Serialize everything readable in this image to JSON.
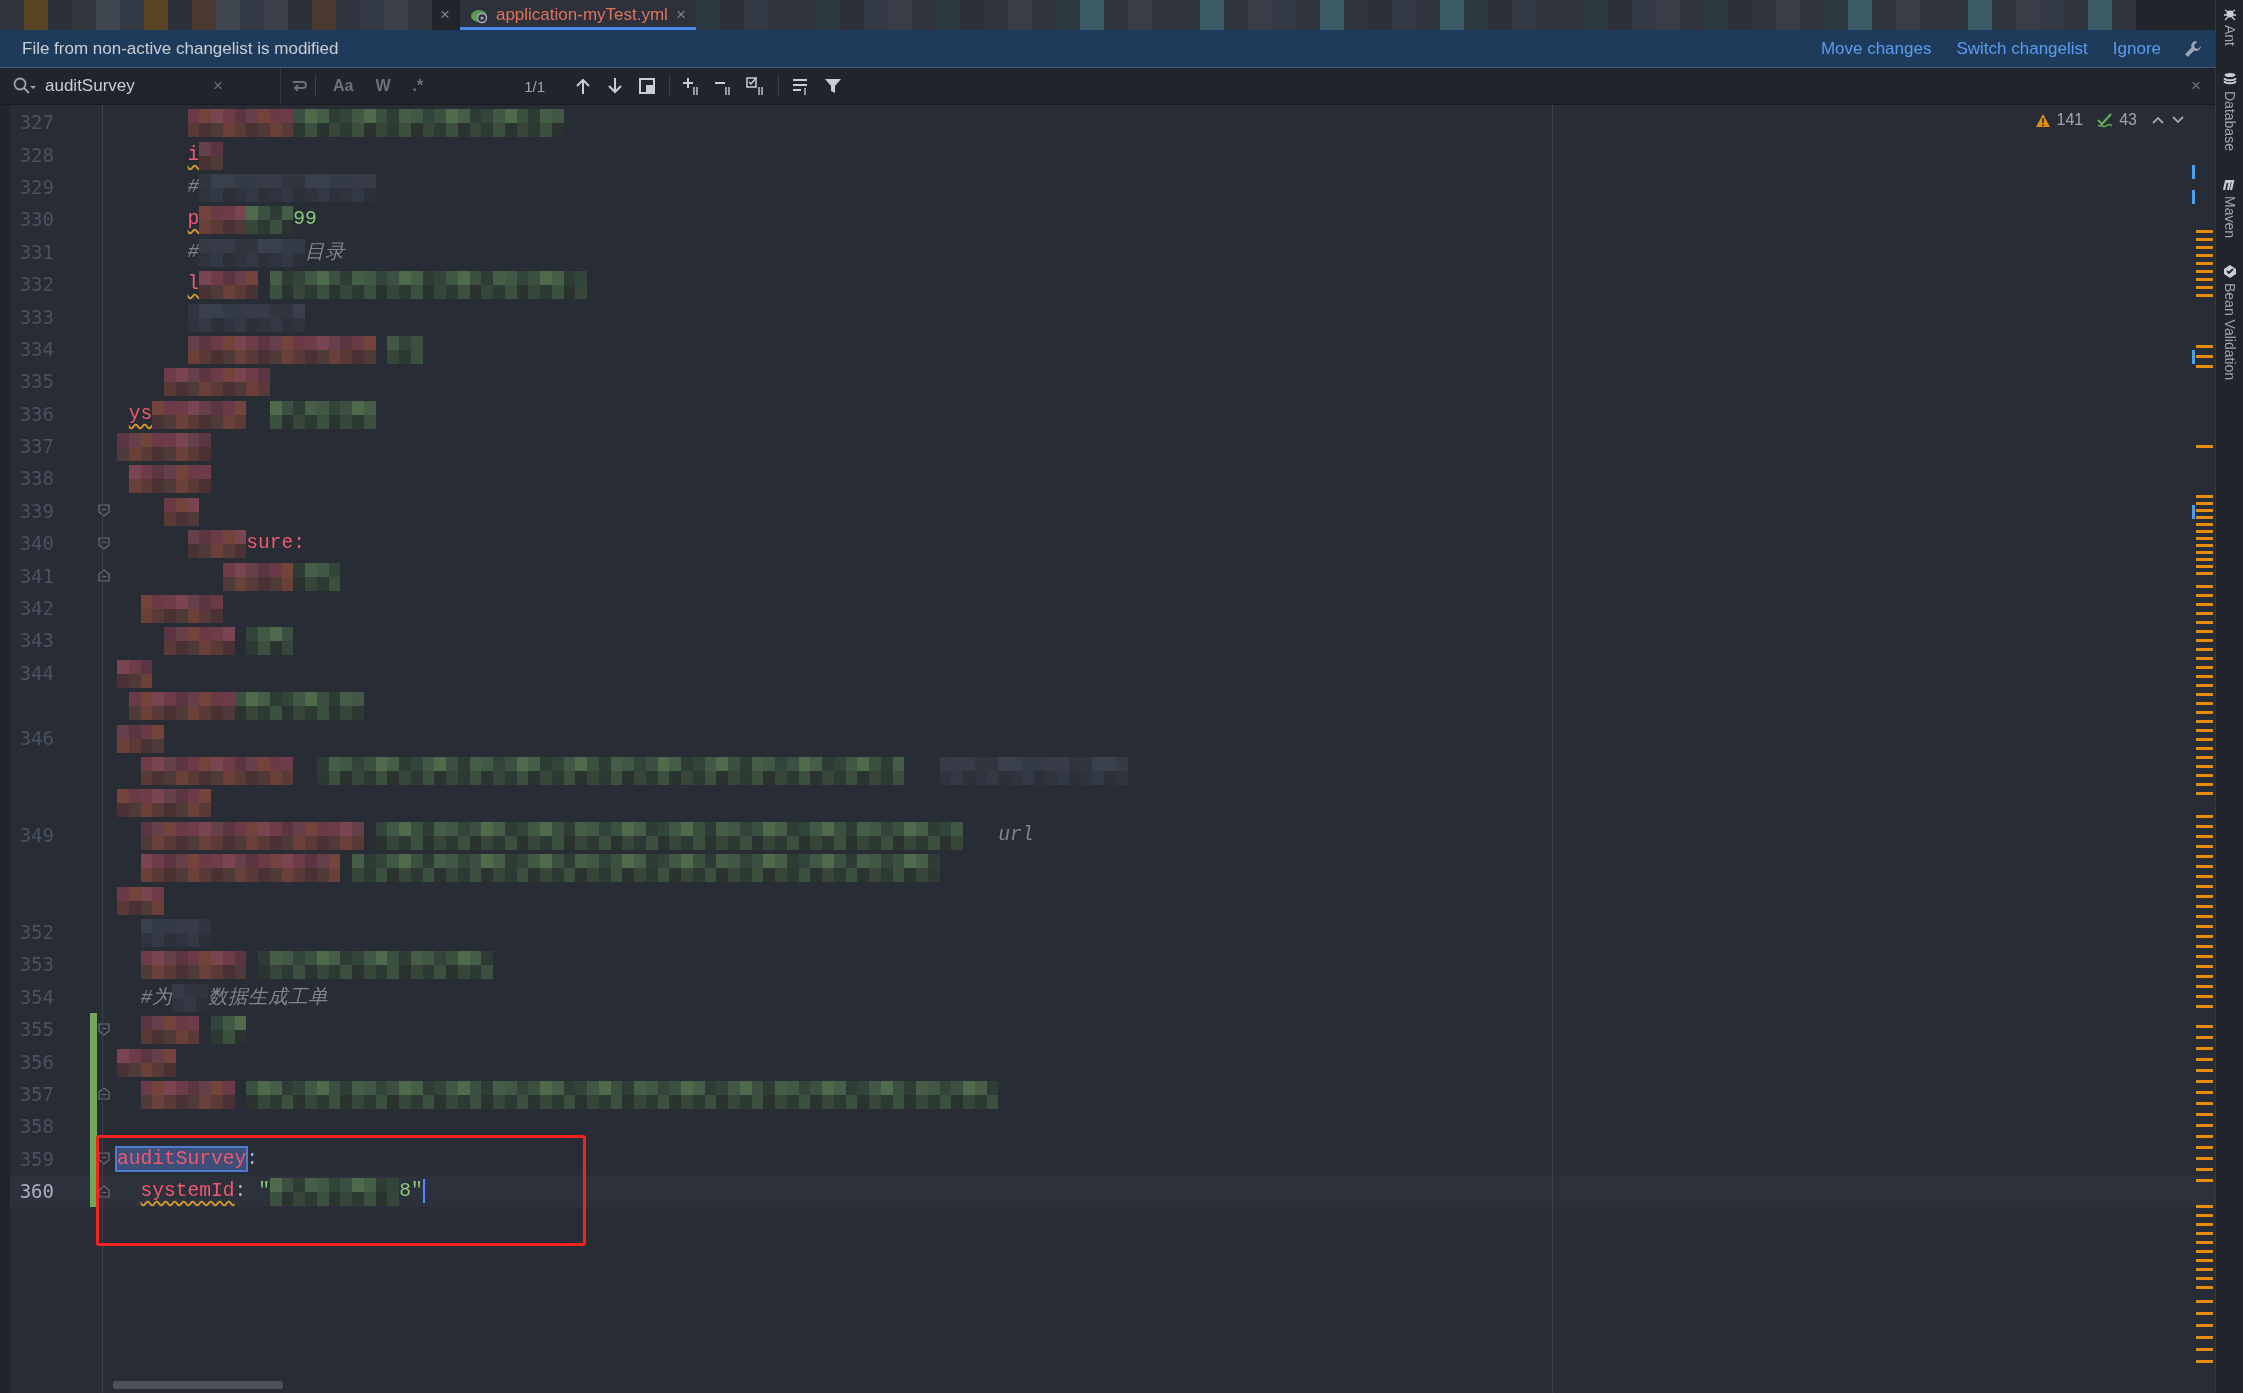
{
  "tabs": [
    {
      "kind": "mosaic",
      "close": "×",
      "selected": false
    },
    {
      "kind": "file",
      "label": "application-myTest.yml",
      "close": "×",
      "selected": true
    }
  ],
  "banner": {
    "message": "File from non-active changelist is modified",
    "actions": [
      "Move changes",
      "Switch changelist",
      "Ignore"
    ]
  },
  "search": {
    "value": "auditSurvey",
    "clear": "×",
    "toggles": [
      {
        "label": "Aa",
        "on": false
      },
      {
        "label": "W",
        "on": false
      },
      {
        "label": ".*",
        "on": false
      }
    ],
    "match_count": "1/1",
    "close": "×"
  },
  "inspections": {
    "warnings": "141",
    "weak_warnings": "43"
  },
  "lines": [
    {
      "number": "327",
      "current": false,
      "changed": false,
      "fold_start": false,
      "fold_end": false
    },
    {
      "number": "328",
      "current": false,
      "changed": false,
      "fold_start": false,
      "fold_end": false,
      "fragments": [
        {
          "kind": "key",
          "text": "i",
          "squiggle": true
        }
      ]
    },
    {
      "number": "329",
      "current": false,
      "changed": false,
      "fold_start": false,
      "fold_end": false,
      "fragments": [
        {
          "kind": "comment",
          "text": "#"
        }
      ]
    },
    {
      "number": "330",
      "current": false,
      "changed": false,
      "fold_start": false,
      "fold_end": false,
      "fragments": [
        {
          "kind": "key",
          "text": "p",
          "squiggle": true
        },
        {
          "kind": "value",
          "text": "99"
        }
      ]
    },
    {
      "number": "331",
      "current": false,
      "changed": false,
      "fold_start": false,
      "fold_end": false,
      "fragments": [
        {
          "kind": "comment",
          "text": "#"
        },
        {
          "kind": "comment",
          "text": "目录"
        }
      ]
    },
    {
      "number": "332",
      "current": false,
      "changed": false,
      "fold_start": false,
      "fold_end": false,
      "fragments": [
        {
          "kind": "key",
          "text": "l",
          "squiggle": true
        }
      ]
    },
    {
      "number": "333",
      "current": false,
      "changed": false,
      "fold_start": false,
      "fold_end": false
    },
    {
      "number": "334",
      "current": false,
      "changed": false,
      "fold_start": false,
      "fold_end": false
    },
    {
      "number": "335",
      "current": false,
      "changed": false,
      "fold_start": false,
      "fold_end": false
    },
    {
      "number": "336",
      "current": false,
      "changed": false,
      "fold_start": false,
      "fold_end": false,
      "fragments": [
        {
          "kind": "key",
          "text": "ys",
          "squiggle": true
        }
      ]
    },
    {
      "number": "337",
      "current": false,
      "changed": false,
      "fold_start": false,
      "fold_end": false
    },
    {
      "number": "338",
      "current": false,
      "changed": false,
      "fold_start": false,
      "fold_end": false
    },
    {
      "number": "339",
      "current": false,
      "changed": false,
      "fold_start": true,
      "fold_end": false
    },
    {
      "number": "340",
      "current": false,
      "changed": false,
      "fold_start": true,
      "fold_end": false,
      "fragments": [
        {
          "kind": "key",
          "text": "sure:"
        }
      ]
    },
    {
      "number": "341",
      "current": false,
      "changed": false,
      "fold_start": false,
      "fold_end": true
    },
    {
      "number": "342",
      "current": false,
      "changed": false,
      "fold_start": false,
      "fold_end": false
    },
    {
      "number": "343",
      "current": false,
      "changed": false,
      "fold_start": false,
      "fold_end": false
    },
    {
      "number": "344",
      "current": false,
      "changed": false,
      "fold_start": false,
      "fold_end": false
    },
    {
      "current": false,
      "changed": false,
      "fold_start": false,
      "fold_end": false
    },
    {
      "number": "346",
      "current": false,
      "changed": false,
      "fold_start": false,
      "fold_end": false
    },
    {
      "current": false,
      "changed": false,
      "fold_start": false,
      "fold_end": false
    },
    {
      "current": false,
      "changed": false,
      "fold_start": false,
      "fold_end": false
    },
    {
      "number": "349",
      "current": false,
      "changed": false,
      "fold_start": false,
      "fold_end": false,
      "fragments": [
        {
          "kind": "comment",
          "text": "url"
        }
      ]
    },
    {
      "current": false,
      "changed": false,
      "fold_start": false,
      "fold_end": false
    },
    {
      "current": false,
      "changed": false,
      "fold_start": false,
      "fold_end": false
    },
    {
      "number": "352",
      "current": false,
      "changed": false,
      "fold_start": false,
      "fold_end": false
    },
    {
      "number": "353",
      "current": false,
      "changed": false,
      "fold_start": false,
      "fold_end": false
    },
    {
      "number": "354",
      "current": false,
      "changed": false,
      "fold_start": false,
      "fold_end": false,
      "fragments": [
        {
          "kind": "comment",
          "text": "#为"
        },
        {
          "kind": "comment",
          "text": "数据生成工单"
        }
      ]
    },
    {
      "number": "355",
      "current": false,
      "changed": true,
      "fold_start": true,
      "fold_end": false
    },
    {
      "number": "356",
      "current": false,
      "changed": true,
      "fold_start": false,
      "fold_end": false
    },
    {
      "number": "357",
      "current": false,
      "changed": true,
      "fold_start": false,
      "fold_end": true
    },
    {
      "number": "358",
      "current": false,
      "changed": true,
      "fold_start": false,
      "fold_end": false
    },
    {
      "number": "359",
      "current": false,
      "changed": true,
      "fold_start": true,
      "fold_end": false,
      "fragments": [
        {
          "kind": "match",
          "text": "auditSurvey"
        },
        {
          "kind": "punct",
          "text": ":"
        }
      ]
    },
    {
      "number": "360",
      "current": true,
      "changed": true,
      "fold_start": false,
      "fold_end": true,
      "fragments": [
        {
          "kind": "key",
          "text": "systemId",
          "squiggle": true
        },
        {
          "kind": "punct",
          "text": ": "
        },
        {
          "kind": "value",
          "text": "\""
        },
        {
          "kind": "value",
          "text": "8\""
        }
      ]
    }
  ],
  "tool_windows": [
    "Ant",
    "Database",
    "Maven",
    "Bean Validation"
  ]
}
